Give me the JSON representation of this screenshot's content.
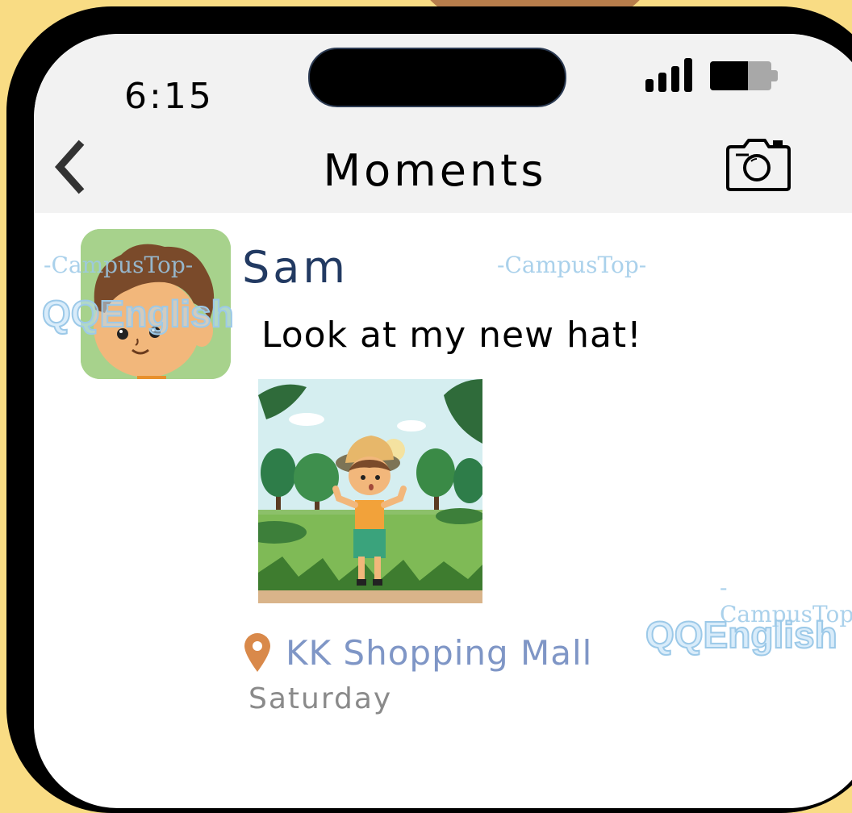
{
  "status_bar": {
    "time": "6:15",
    "signal_icon": "cellular-signal-icon",
    "battery_icon": "battery-icon",
    "battery_level": 0.62
  },
  "nav": {
    "back_icon": "chevron-left-icon",
    "title": "Moments",
    "camera_icon": "camera-icon"
  },
  "post": {
    "author": "Sam",
    "text": "Look at my new hat!",
    "location_icon": "map-pin-icon",
    "location": "KK Shopping Mall",
    "day": "Saturday"
  },
  "watermark": {
    "sub": "-CampusTop-",
    "brand": "QQEnglish"
  },
  "colors": {
    "background": "#f9dc84",
    "nav_bar": "#f2f2f2",
    "author_name": "#223a62",
    "location_text": "#7f96c6",
    "location_pin": "#d9894a",
    "day_text": "#8a8a8a",
    "avatar_bg": "#a7d28c",
    "watermark": "#9cc9e8"
  }
}
